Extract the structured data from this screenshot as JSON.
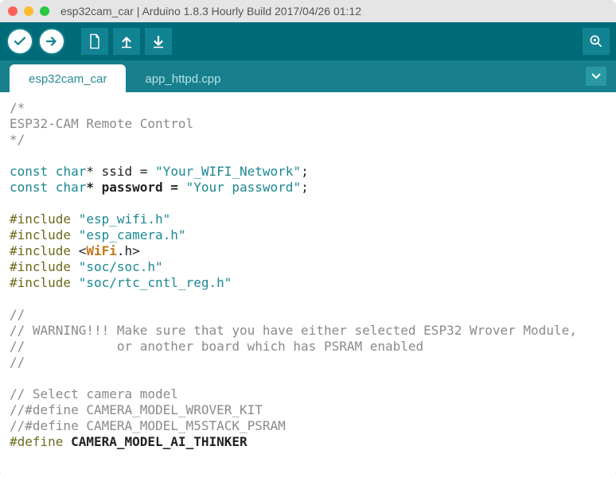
{
  "window": {
    "title": "esp32cam_car | Arduino 1.8.3 Hourly Build 2017/04/26 01:12"
  },
  "tabs": {
    "active": "esp32cam_car",
    "inactive": "app_httpd.cpp"
  },
  "icons": {
    "verify": "check-icon",
    "upload": "arrow-right-icon",
    "new": "file-icon",
    "open": "arrow-up-icon",
    "save": "arrow-down-icon",
    "serial": "serial-monitor-icon"
  },
  "code": {
    "l1": "/*",
    "l2": "ESP32-CAM Remote Control",
    "l3": "*/",
    "l4": "",
    "l5a": "const",
    "l5b": " char",
    "l5c": "* ssid = ",
    "l5d": "\"Your_WIFI_Network\"",
    "l5e": ";",
    "l6a": "const",
    "l6b": " char",
    "l6c": "* password = ",
    "l6d": "\"Your password\"",
    "l6e": ";",
    "l7": "",
    "l8a": "#include",
    "l8b": " \"esp_wifi.h\"",
    "l9a": "#include",
    "l9b": " \"esp_camera.h\"",
    "l10a": "#include",
    "l10b": " <",
    "l10c": "WiFi",
    "l10d": ".h>",
    "l11a": "#include",
    "l11b": " \"soc/soc.h\"",
    "l12a": "#include",
    "l12b": " \"soc/rtc_cntl_reg.h\"",
    "l13": "",
    "l14": "//",
    "l15": "// WARNING!!! Make sure that you have either selected ESP32 Wrover Module,",
    "l16": "//            or another board which has PSRAM enabled",
    "l17": "//",
    "l18": "",
    "l19": "// Select camera model",
    "l20": "//#define CAMERA_MODEL_WROVER_KIT",
    "l21": "//#define CAMERA_MODEL_M5STACK_PSRAM",
    "l22a": "#define",
    "l22b": " CAMERA_MODEL_AI_THINKER"
  }
}
